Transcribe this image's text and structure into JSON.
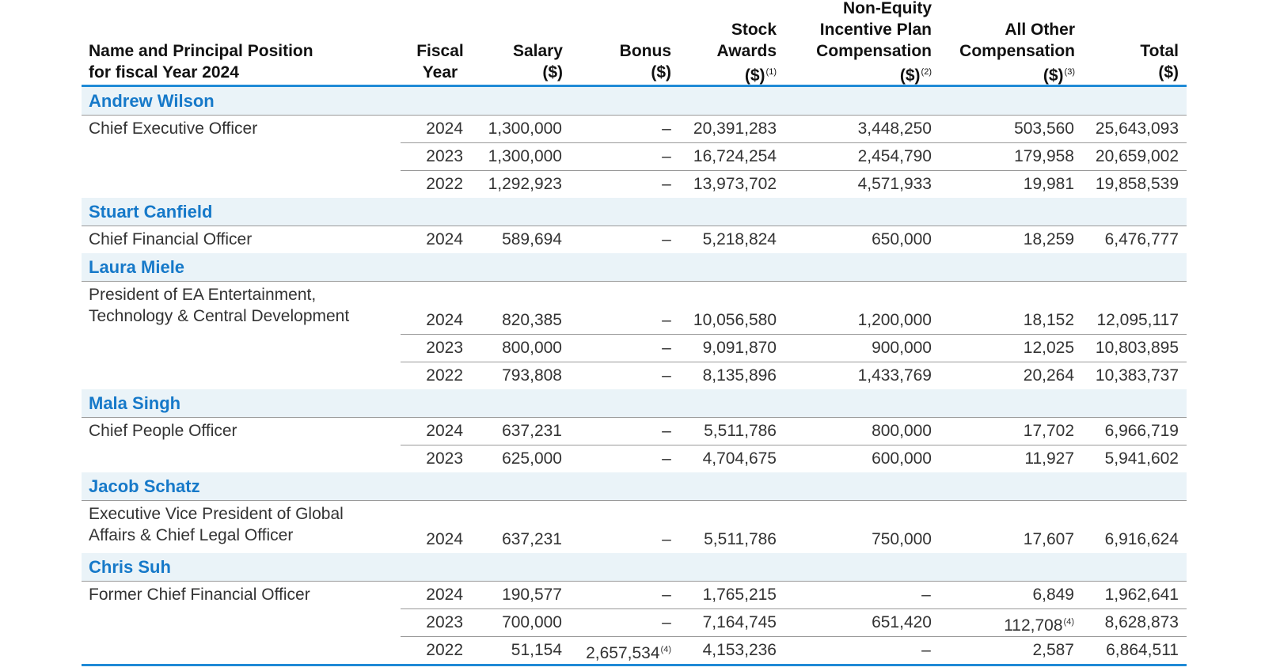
{
  "headers": {
    "name": [
      "Name and Principal Position",
      "for fiscal Year 2024"
    ],
    "year": [
      "Fiscal",
      "Year"
    ],
    "salary": [
      "Salary",
      "($)"
    ],
    "bonus": [
      "Bonus",
      "($)"
    ],
    "stock": [
      "Stock",
      "Awards",
      "($)"
    ],
    "stock_fn": "(1)",
    "nonequity": [
      "Non-Equity",
      "Incentive Plan",
      "Compensation",
      "($)"
    ],
    "nonequity_fn": "(2)",
    "other": [
      "All Other",
      "Compensation",
      "($)"
    ],
    "other_fn": "(3)",
    "total": [
      "Total",
      "($)"
    ]
  },
  "executives": [
    {
      "name": "Andrew Wilson",
      "position": [
        "Chief Executive Officer"
      ],
      "rows": [
        {
          "year": "2024",
          "salary": "1,300,000",
          "bonus": "–",
          "stock": "20,391,283",
          "nonequity": "3,448,250",
          "other": "503,560",
          "total": "25,643,093"
        },
        {
          "year": "2023",
          "salary": "1,300,000",
          "bonus": "–",
          "stock": "16,724,254",
          "nonequity": "2,454,790",
          "other": "179,958",
          "total": "20,659,002"
        },
        {
          "year": "2022",
          "salary": "1,292,923",
          "bonus": "–",
          "stock": "13,973,702",
          "nonequity": "4,571,933",
          "other": "19,981",
          "total": "19,858,539"
        }
      ]
    },
    {
      "name": "Stuart Canfield",
      "position": [
        "Chief Financial Officer"
      ],
      "rows": [
        {
          "year": "2024",
          "salary": "589,694",
          "bonus": "–",
          "stock": "5,218,824",
          "nonequity": "650,000",
          "other": "18,259",
          "total": "6,476,777"
        }
      ]
    },
    {
      "name": "Laura Miele",
      "position": [
        "President of EA Entertainment,",
        "Technology & Central Development"
      ],
      "rows": [
        {
          "year": "2024",
          "salary": "820,385",
          "bonus": "–",
          "stock": "10,056,580",
          "nonequity": "1,200,000",
          "other": "18,152",
          "total": "12,095,117"
        },
        {
          "year": "2023",
          "salary": "800,000",
          "bonus": "–",
          "stock": "9,091,870",
          "nonequity": "900,000",
          "other": "12,025",
          "total": "10,803,895"
        },
        {
          "year": "2022",
          "salary": "793,808",
          "bonus": "–",
          "stock": "8,135,896",
          "nonequity": "1,433,769",
          "other": "20,264",
          "total": "10,383,737"
        }
      ]
    },
    {
      "name": "Mala Singh",
      "position": [
        "Chief People Officer"
      ],
      "rows": [
        {
          "year": "2024",
          "salary": "637,231",
          "bonus": "–",
          "stock": "5,511,786",
          "nonequity": "800,000",
          "other": "17,702",
          "total": "6,966,719"
        },
        {
          "year": "2023",
          "salary": "625,000",
          "bonus": "–",
          "stock": "4,704,675",
          "nonequity": "600,000",
          "other": "11,927",
          "total": "5,941,602"
        }
      ]
    },
    {
      "name": "Jacob Schatz",
      "position": [
        "Executive Vice President of Global",
        "Affairs & Chief Legal Officer"
      ],
      "rows": [
        {
          "year": "2024",
          "salary": "637,231",
          "bonus": "–",
          "stock": "5,511,786",
          "nonequity": "750,000",
          "other": "17,607",
          "total": "6,916,624"
        }
      ]
    },
    {
      "name": "Chris Suh",
      "position": [
        "Former Chief Financial Officer"
      ],
      "rows": [
        {
          "year": "2024",
          "salary": "190,577",
          "bonus": "–",
          "stock": "1,765,215",
          "nonequity": "–",
          "other": "6,849",
          "total": "1,962,641"
        },
        {
          "year": "2023",
          "salary": "700,000",
          "bonus": "–",
          "stock": "7,164,745",
          "nonequity": "651,420",
          "other": "112,708",
          "other_fn": "(4)",
          "total": "8,628,873"
        },
        {
          "year": "2022",
          "salary": "51,154",
          "bonus": "2,657,534",
          "bonus_fn": "(4)",
          "stock": "4,153,236",
          "nonequity": "–",
          "other": "2,587",
          "total": "6,864,511"
        }
      ]
    }
  ]
}
